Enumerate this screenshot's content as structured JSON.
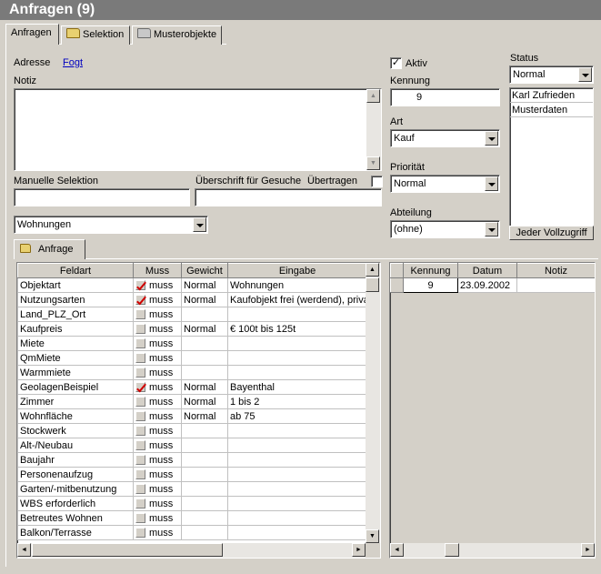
{
  "window": {
    "title": "Anfragen (9)"
  },
  "tabs": [
    {
      "label": "Anfragen",
      "icon": "none"
    },
    {
      "label": "Selektion",
      "icon": "folder-open-icon"
    },
    {
      "label": "Musterobjekte",
      "icon": "folder-grey-icon"
    }
  ],
  "form": {
    "adresse_label": "Adresse",
    "adresse_link": "Fogt",
    "notiz_label": "Notiz",
    "notiz_value": "",
    "manuelle_selektion_label": "Manuelle Selektion",
    "manuelle_selektion_value": "",
    "ueberschrift_label": "Überschrift für Gesuche",
    "ueberschrift_value": "",
    "uebertragen_label": "Übertragen",
    "wohnart_value": "Wohnungen"
  },
  "right": {
    "aktiv_label": "Aktiv",
    "aktiv_checked": true,
    "kennung_label": "Kennung",
    "kennung_value": "9",
    "art_label": "Art",
    "art_value": "Kauf",
    "prioritaet_label": "Priorität",
    "prioritaet_value": "Normal",
    "abteilung_label": "Abteilung",
    "abteilung_value": "(ohne)",
    "status_label": "Status",
    "status_value": "Normal",
    "status_list": [
      "Karl Zufrieden",
      "Musterdaten"
    ],
    "vollzugriff_label": "Jeder Vollzugriff"
  },
  "anfrage_tab": {
    "label": "Anfrage"
  },
  "criteria_table": {
    "headers": [
      "Feldart",
      "Muss",
      "Gewicht",
      "Eingabe"
    ],
    "rows": [
      {
        "feldart": "Objektart",
        "checked": true,
        "muss": "muss",
        "gewicht": "Normal",
        "eingabe": "Wohnungen"
      },
      {
        "feldart": "Nutzungsarten",
        "checked": true,
        "muss": "muss",
        "gewicht": "Normal",
        "eingabe": "Kaufobjekt frei (werdend), privat"
      },
      {
        "feldart": "Land_PLZ_Ort",
        "checked": false,
        "muss": "muss",
        "gewicht": "",
        "eingabe": ""
      },
      {
        "feldart": "Kaufpreis",
        "checked": false,
        "muss": "muss",
        "gewicht": "Normal",
        "eingabe": "€ 100t bis 125t"
      },
      {
        "feldart": "Miete",
        "checked": false,
        "muss": "muss",
        "gewicht": "",
        "eingabe": ""
      },
      {
        "feldart": "QmMiete",
        "checked": false,
        "muss": "muss",
        "gewicht": "",
        "eingabe": ""
      },
      {
        "feldart": "Warmmiete",
        "checked": false,
        "muss": "muss",
        "gewicht": "",
        "eingabe": ""
      },
      {
        "feldart": "GeolagenBeispiel",
        "checked": true,
        "muss": "muss",
        "gewicht": "Normal",
        "eingabe": "Bayenthal"
      },
      {
        "feldart": "Zimmer",
        "checked": false,
        "muss": "muss",
        "gewicht": "Normal",
        "eingabe": "1 bis 2"
      },
      {
        "feldart": "Wohnfläche",
        "checked": false,
        "muss": "muss",
        "gewicht": "Normal",
        "eingabe": "ab 75"
      },
      {
        "feldart": "Stockwerk",
        "checked": false,
        "muss": "muss",
        "gewicht": "",
        "eingabe": ""
      },
      {
        "feldart": "Alt-/Neubau",
        "checked": false,
        "muss": "muss",
        "gewicht": "",
        "eingabe": ""
      },
      {
        "feldart": "Baujahr",
        "checked": false,
        "muss": "muss",
        "gewicht": "",
        "eingabe": ""
      },
      {
        "feldart": "Personenaufzug",
        "checked": false,
        "muss": "muss",
        "gewicht": "",
        "eingabe": ""
      },
      {
        "feldart": "Garten/-mitbenutzung",
        "checked": false,
        "muss": "muss",
        "gewicht": "",
        "eingabe": ""
      },
      {
        "feldart": "WBS erforderlich",
        "checked": false,
        "muss": "muss",
        "gewicht": "",
        "eingabe": ""
      },
      {
        "feldart": "Betreutes Wohnen",
        "checked": false,
        "muss": "muss",
        "gewicht": "",
        "eingabe": ""
      },
      {
        "feldart": "Balkon/Terrasse",
        "checked": false,
        "muss": "muss",
        "gewicht": "",
        "eingabe": ""
      }
    ]
  },
  "history_table": {
    "headers": [
      "Kennung",
      "Datum",
      "Notiz"
    ],
    "rows": [
      {
        "kennung": "9",
        "datum": "23.09.2002",
        "notiz": ""
      }
    ]
  },
  "icons": {
    "scroll_up": "▲",
    "scroll_down": "▼",
    "scroll_left": "◄",
    "scroll_right": "►",
    "checkmark": "✓"
  },
  "colors": {
    "titlebar": "#7a7a7a",
    "panel": "#d4d0c8",
    "link": "#0000c0",
    "check_red": "#d00000"
  }
}
